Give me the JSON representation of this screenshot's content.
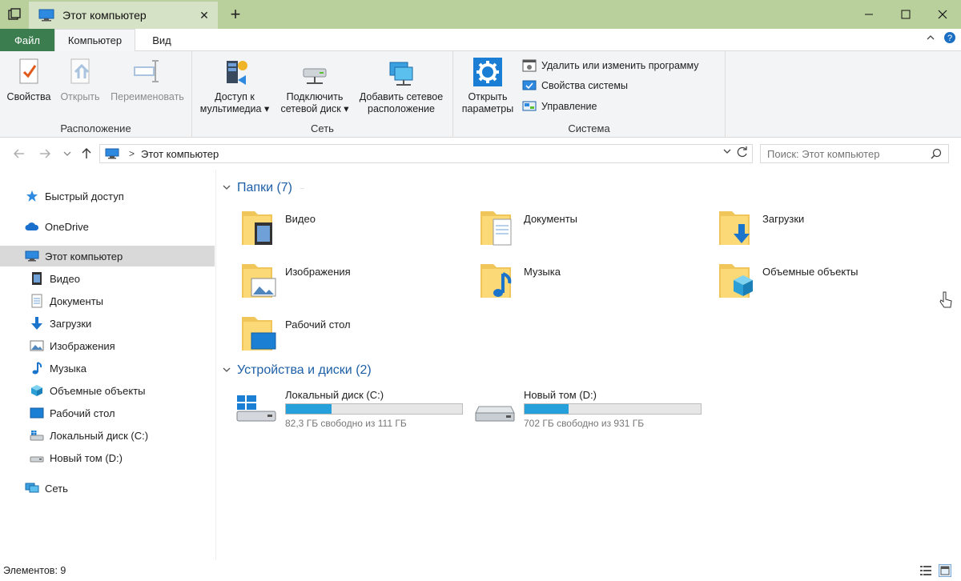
{
  "window": {
    "tab_title": "Этот компьютер",
    "close_tab": "✕",
    "new_tab": "+"
  },
  "ribbon_tabs": {
    "file": "Файл",
    "computer": "Компьютер",
    "view": "Вид"
  },
  "ribbon": {
    "location": {
      "label": "Расположение",
      "properties": "Свойства",
      "open": "Открыть",
      "rename": "Переименовать"
    },
    "network": {
      "label": "Сеть",
      "media_access_1": "Доступ к",
      "media_access_2": "мультимедиа ▾",
      "map_drive_1": "Подключить",
      "map_drive_2": "сетевой диск ▾",
      "add_location_1": "Добавить сетевое",
      "add_location_2": "расположение"
    },
    "system": {
      "label": "Система",
      "open_settings_1": "Открыть",
      "open_settings_2": "параметры",
      "uninstall": "Удалить или изменить программу",
      "system_properties": "Свойства системы",
      "manage": "Управление"
    }
  },
  "address": {
    "path": "Этот компьютер",
    "separator": ">",
    "search_placeholder": "Поиск: Этот компьютер"
  },
  "nav": {
    "quick_access": "Быстрый доступ",
    "onedrive": "OneDrive",
    "this_pc": "Этот компьютер",
    "children": [
      "Видео",
      "Документы",
      "Загрузки",
      "Изображения",
      "Музыка",
      "Объемные объекты",
      "Рабочий стол",
      "Локальный диск (C:)",
      "Новый том (D:)"
    ],
    "network": "Сеть"
  },
  "folders": {
    "header": "Папки (7)",
    "items": [
      "Видео",
      "Документы",
      "Загрузки",
      "Изображения",
      "Музыка",
      "Объемные объекты",
      "Рабочий стол"
    ]
  },
  "drives": {
    "header": "Устройства и диски (2)",
    "items": [
      {
        "name": "Локальный диск (C:)",
        "free": "82,3 ГБ свободно из 111 ГБ",
        "used_fraction": 0.26
      },
      {
        "name": "Новый том (D:)",
        "free": "702 ГБ свободно из 931 ГБ",
        "used_fraction": 0.25
      }
    ]
  },
  "status": {
    "items_count": "Элементов: 9"
  },
  "colors": {
    "titlebar": "#b9cf9c",
    "file_tab": "#3c7d4f",
    "accent": "#1d5fa6",
    "drive_bar": "#26a0da"
  }
}
